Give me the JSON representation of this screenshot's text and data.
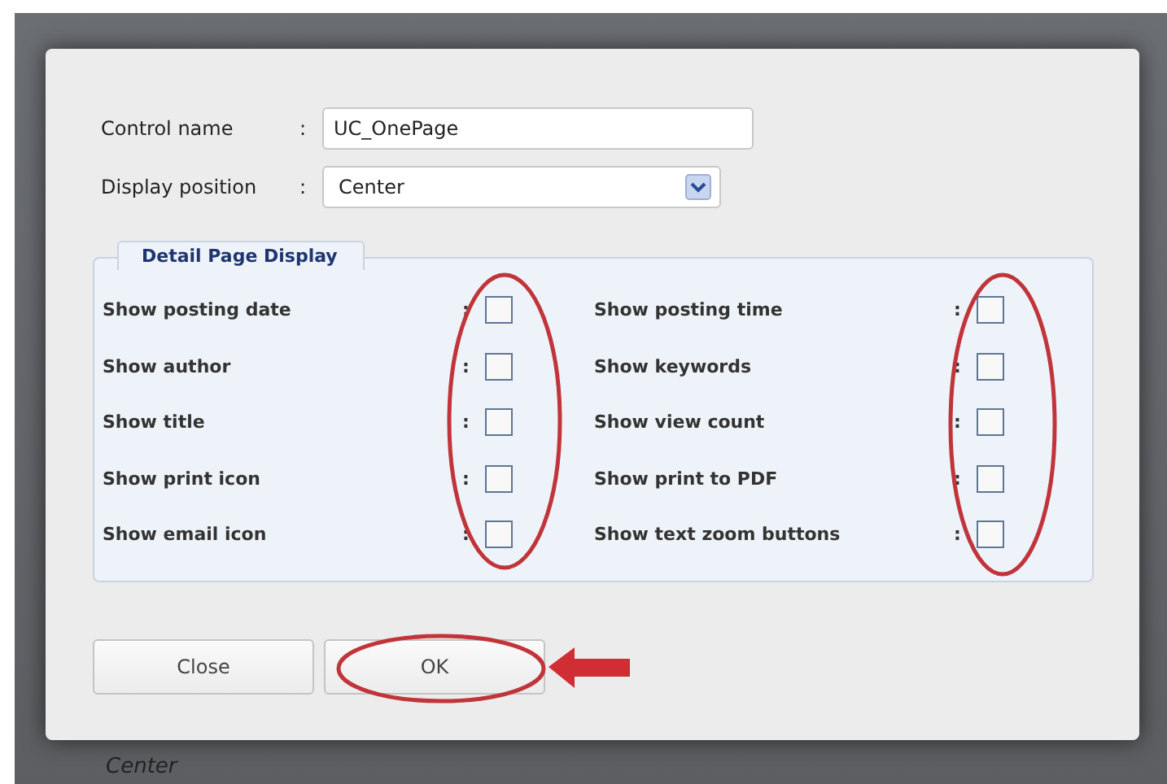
{
  "dialog": {
    "fields": [
      {
        "label": "Control name",
        "colon": ":",
        "kind": "text",
        "value": "UC_OnePage"
      },
      {
        "label": "Display position",
        "colon": ":",
        "kind": "select",
        "value": "Center"
      }
    ],
    "fieldset": {
      "legend": "Detail Page Display",
      "columns": [
        [
          {
            "label": "Show posting date",
            "colon": ":",
            "checked": false
          },
          {
            "label": "Show author",
            "colon": ":",
            "checked": false
          },
          {
            "label": "Show title",
            "colon": ":",
            "checked": false
          },
          {
            "label": "Show print icon",
            "colon": ":",
            "checked": false
          },
          {
            "label": "Show email icon",
            "colon": ":",
            "checked": false
          }
        ],
        [
          {
            "label": "Show posting time",
            "colon": ":",
            "checked": false
          },
          {
            "label": "Show keywords",
            "colon": ":",
            "checked": false
          },
          {
            "label": "Show view count",
            "colon": ":",
            "checked": false
          },
          {
            "label": "Show print to PDF",
            "colon": ":",
            "checked": false
          },
          {
            "label": "Show text zoom buttons",
            "colon": ":",
            "checked": false
          }
        ]
      ]
    },
    "buttons": [
      "Close",
      "OK"
    ]
  },
  "background_text": "Center"
}
